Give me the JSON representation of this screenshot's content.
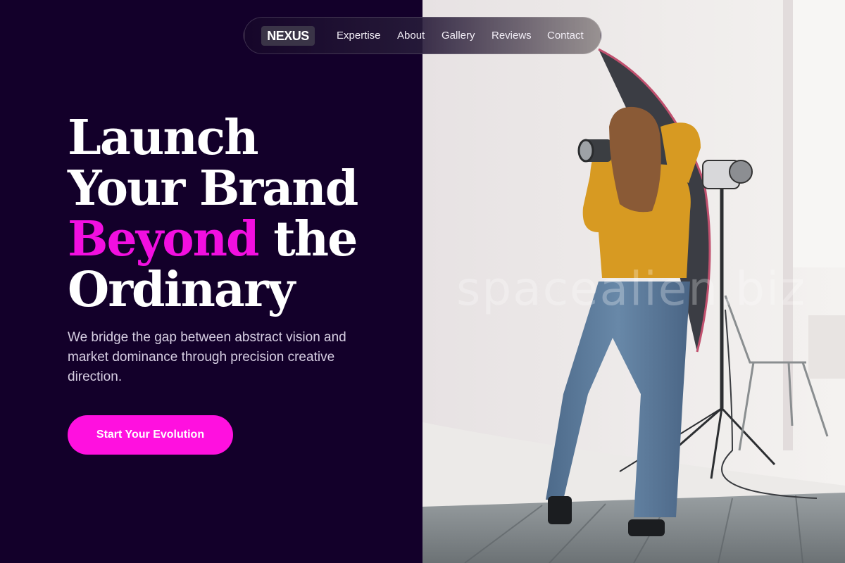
{
  "brand": {
    "logo_text": "NEXUS"
  },
  "nav": {
    "links": [
      "Expertise",
      "About",
      "Gallery",
      "Reviews",
      "Contact"
    ]
  },
  "hero": {
    "headline_line1": "Launch",
    "headline_line2": "Your Brand",
    "headline_accent": "Beyond",
    "headline_line3_rest": " the",
    "headline_line4": "Ordinary",
    "subtext": "We bridge the gap between abstract vision and market dominance through precision creative direction.",
    "cta_label": "Start Your Evolution"
  },
  "photo": {
    "watermark": "spacealien.biz",
    "description_icon": "photographer-photo"
  },
  "colors": {
    "background": "#13002a",
    "accent": "#f20fe0",
    "cta": "#ff10df",
    "text": "#ffffff"
  }
}
